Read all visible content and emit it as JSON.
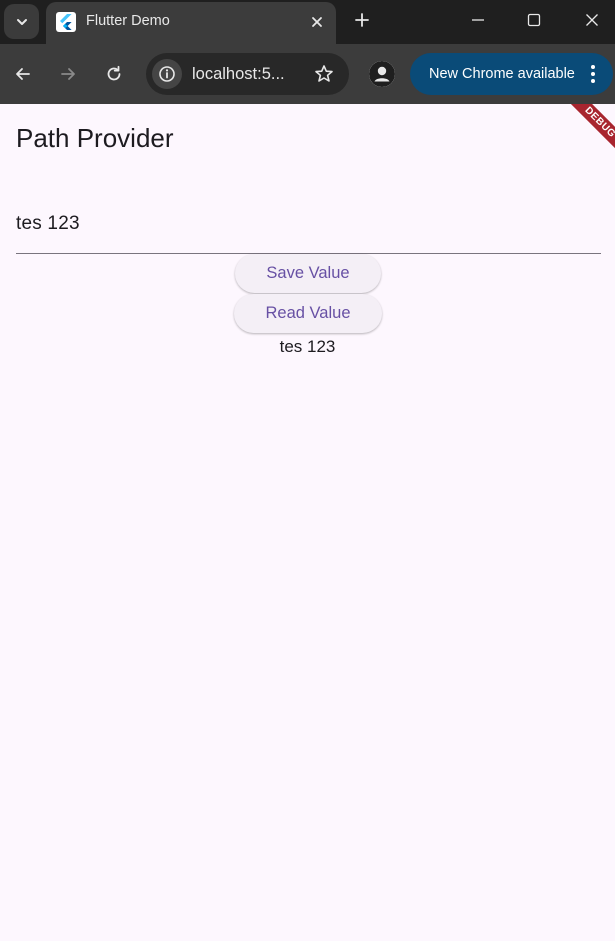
{
  "browser": {
    "tab": {
      "title": "Flutter Demo"
    },
    "omnibox": {
      "url": "localhost:5..."
    },
    "update_button": {
      "label": "New Chrome available"
    }
  },
  "app": {
    "title": "Path Provider",
    "debug_banner": "DEBUG",
    "text_field": {
      "value": "tes 123"
    },
    "save_button": {
      "label": "Save Value"
    },
    "read_button": {
      "label": "Read Value"
    },
    "read_result": "tes 123"
  },
  "colors": {
    "page_background": "#fdf7fe",
    "button_text": "#6750a4",
    "update_pill": "#0a4b78",
    "debug_banner": "#a8252f"
  },
  "icons": {
    "tab_search": "chevron-down-icon",
    "favicon": "flutter-logo-icon",
    "tab_close": "close-icon",
    "new_tab": "plus-icon",
    "window_minimize": "minimize-icon",
    "window_maximize": "maximize-icon",
    "window_close": "close-icon",
    "back": "arrow-left-icon",
    "forward": "arrow-right-icon",
    "reload": "reload-icon",
    "site_info": "info-icon",
    "bookmark": "star-icon",
    "profile": "profile-icon",
    "menu": "more-vertical-icon"
  }
}
